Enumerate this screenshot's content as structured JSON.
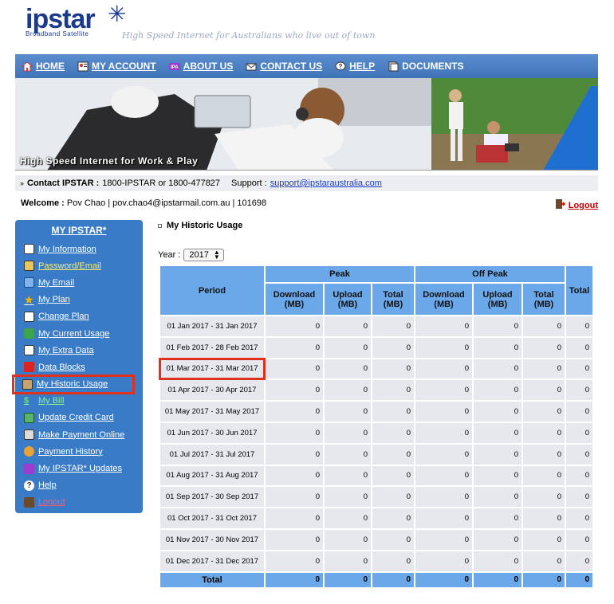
{
  "header": {
    "logo_text": "ipstar",
    "logo_sub": "Broadband Satellite",
    "tagline": "High Speed Internet for Australians who live out of town"
  },
  "nav": [
    {
      "label": "HOME",
      "icon": "home-icon"
    },
    {
      "label": "MY ACCOUNT",
      "icon": "account-icon"
    },
    {
      "label": "ABOUT US",
      "icon": "about-icon"
    },
    {
      "label": "CONTACT US",
      "icon": "contact-icon"
    },
    {
      "label": "HELP",
      "icon": "help-icon"
    },
    {
      "label": "DOCUMENTS",
      "icon": "documents-icon"
    }
  ],
  "banner": {
    "text": "High Speed Internet for Work & Play"
  },
  "contact": {
    "label": "Contact IPSTAR :",
    "phones": "1800-IPSTAR or 1800-477827",
    "support_label": "Support :",
    "support_email": "support@ipstaraustralia.com"
  },
  "welcome": {
    "label": "Welcome :",
    "info": "Pov Chao | pov.chao4@ipstarmail.com.au | 101698",
    "logout": "Logout"
  },
  "sidebar": {
    "title": "MY IPSTAR*",
    "items": [
      {
        "label": "My Information"
      },
      {
        "label": "Password/Email"
      },
      {
        "label": "My Email"
      },
      {
        "label": "My Plan"
      },
      {
        "label": "Change Plan"
      },
      {
        "label": "My Current Usage"
      },
      {
        "label": "My Extra Data"
      },
      {
        "label": "Data Blocks"
      },
      {
        "label": "My Historic Usage"
      },
      {
        "label": "My Bill"
      },
      {
        "label": "Update Credit Card"
      },
      {
        "label": "Make Payment Online"
      },
      {
        "label": "Payment History"
      },
      {
        "label": "My IPSTAR* Updates"
      },
      {
        "label": "Help"
      },
      {
        "label": "Logout"
      }
    ]
  },
  "main": {
    "title": "My Historic Usage",
    "year_label": "Year :",
    "year_value": "2017",
    "table": {
      "period_header": "Period",
      "peak_header": "Peak",
      "offpeak_header": "Off Peak",
      "total_header": "Total",
      "sub_download": "Download (MB)",
      "sub_upload": "Upload (MB)",
      "sub_total": "Total (MB)",
      "total_row_label": "Total",
      "rows": [
        {
          "period": "01 Jan 2017 - 31 Jan 2017",
          "v": [
            "0",
            "0",
            "0",
            "0",
            "0",
            "0",
            "0"
          ]
        },
        {
          "period": "01 Feb 2017 - 28 Feb 2017",
          "v": [
            "0",
            "0",
            "0",
            "0",
            "0",
            "0",
            "0"
          ]
        },
        {
          "period": "01 Mar 2017 - 31 Mar 2017",
          "v": [
            "0",
            "0",
            "0",
            "0",
            "0",
            "0",
            "0"
          ]
        },
        {
          "period": "01 Apr 2017 - 30 Apr 2017",
          "v": [
            "0",
            "0",
            "0",
            "0",
            "0",
            "0",
            "0"
          ]
        },
        {
          "period": "01 May 2017 - 31 May 2017",
          "v": [
            "0",
            "0",
            "0",
            "0",
            "0",
            "0",
            "0"
          ]
        },
        {
          "period": "01 Jun 2017 - 30 Jun 2017",
          "v": [
            "0",
            "0",
            "0",
            "0",
            "0",
            "0",
            "0"
          ]
        },
        {
          "period": "01 Jul 2017 - 31 Jul 2017",
          "v": [
            "0",
            "0",
            "0",
            "0",
            "0",
            "0",
            "0"
          ]
        },
        {
          "period": "01 Aug 2017 - 31 Aug 2017",
          "v": [
            "0",
            "0",
            "0",
            "0",
            "0",
            "0",
            "0"
          ]
        },
        {
          "period": "01 Sep 2017 - 30 Sep 2017",
          "v": [
            "0",
            "0",
            "0",
            "0",
            "0",
            "0",
            "0"
          ]
        },
        {
          "period": "01 Oct 2017 - 31 Oct 2017",
          "v": [
            "0",
            "0",
            "0",
            "0",
            "0",
            "0",
            "0"
          ]
        },
        {
          "period": "01 Nov 2017 - 30 Nov 2017",
          "v": [
            "0",
            "0",
            "0",
            "0",
            "0",
            "0",
            "0"
          ]
        },
        {
          "period": "01 Dec 2017 - 31 Dec 2017",
          "v": [
            "0",
            "0",
            "0",
            "0",
            "0",
            "0",
            "0"
          ]
        }
      ],
      "totals": [
        "0",
        "0",
        "0",
        "0",
        "0",
        "0",
        "0"
      ]
    }
  },
  "colors": {
    "nav_blue": "#3f73b8",
    "sidebar_blue": "#3a7bc8",
    "table_header": "#6aa8ea",
    "highlight_red": "#e0301e",
    "link_blue": "#1a3cc8"
  }
}
